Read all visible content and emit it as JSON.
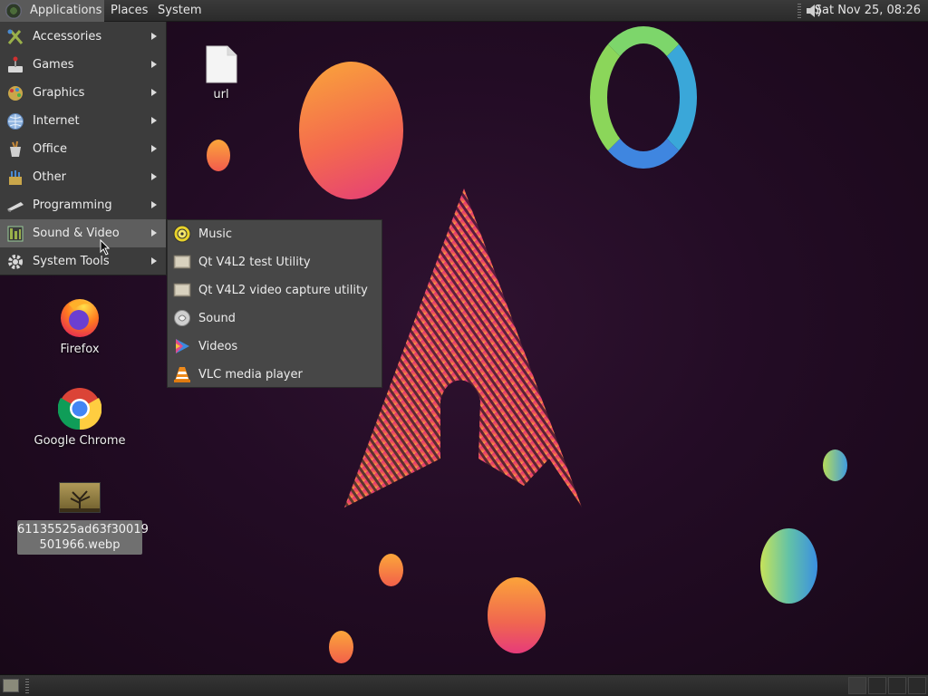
{
  "top_panel": {
    "applications": "Applications",
    "places": "Places",
    "system": "System",
    "clock": "Sat Nov 25, 08:26"
  },
  "apps_menu": {
    "items": [
      {
        "label": "Accessories",
        "icon": "accessories-icon"
      },
      {
        "label": "Games",
        "icon": "games-icon"
      },
      {
        "label": "Graphics",
        "icon": "graphics-icon"
      },
      {
        "label": "Internet",
        "icon": "internet-icon"
      },
      {
        "label": "Office",
        "icon": "office-icon"
      },
      {
        "label": "Other",
        "icon": "other-icon"
      },
      {
        "label": "Programming",
        "icon": "programming-icon"
      },
      {
        "label": "Sound & Video",
        "icon": "sound-video-icon",
        "highlighted": true
      },
      {
        "label": "System Tools",
        "icon": "system-tools-icon"
      }
    ]
  },
  "submenu": {
    "items": [
      {
        "label": "Music",
        "icon": "music-icon"
      },
      {
        "label": "Qt V4L2 test Utility",
        "icon": "qv4l2-icon"
      },
      {
        "label": "Qt V4L2 video capture utility",
        "icon": "qvidcap-icon"
      },
      {
        "label": "Sound",
        "icon": "sound-icon"
      },
      {
        "label": "Videos",
        "icon": "videos-icon"
      },
      {
        "label": "VLC media player",
        "icon": "vlc-icon"
      }
    ]
  },
  "desktop": {
    "url_file": "url",
    "firefox": "Firefox",
    "chrome": "Google Chrome",
    "image_file_line1": "61135525ad63f30019",
    "image_file_line2": "501966.webp"
  },
  "colors": {
    "panel": "#2b2b2b",
    "menu": "#3c3c3c",
    "menu_highlight": "#5e5e5e",
    "wallpaper": "#230c25"
  }
}
